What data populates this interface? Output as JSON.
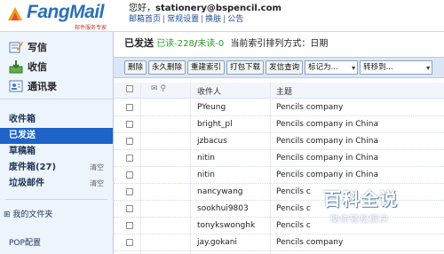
{
  "header": {
    "logo_text": "FangMail",
    "logo_sub": "邮件服务专家",
    "greeting_prefix": "您好，",
    "account": "stationery@bspencil.com",
    "nav": [
      "邮箱首页",
      "常规设置",
      "换肤",
      "公告"
    ]
  },
  "sidebar": {
    "quick": [
      {
        "label": "写信",
        "icon": "compose-icon"
      },
      {
        "label": "收信",
        "icon": "receive-icon"
      },
      {
        "label": "通讯录",
        "icon": "addressbook-icon"
      }
    ],
    "folders": [
      {
        "label": "收件箱",
        "active": false
      },
      {
        "label": "已发送",
        "active": true
      },
      {
        "label": "草稿箱",
        "active": false
      },
      {
        "label": "废件箱(27)",
        "active": false,
        "empty": "清空"
      },
      {
        "label": "垃圾邮件",
        "active": false,
        "empty": "清空"
      }
    ],
    "my_folders": "我的文件夹",
    "pop": "POP配置"
  },
  "main": {
    "title": "已发送",
    "read_label": "已读-228",
    "unread_label": "未读-0",
    "sort_text": "当前索引排列方式：日期",
    "toolbar": {
      "buttons": [
        "删除",
        "永久删除",
        "重建索引",
        "打包下载",
        "发信查询"
      ],
      "mark_as": "标记为...",
      "move_to": "转移到..."
    },
    "columns": {
      "recipient": "收件人",
      "subject": "主题"
    },
    "rows": [
      {
        "to": "PYeung",
        "subject": "Pencils company"
      },
      {
        "to": "bright_pl",
        "subject": "Pencils company in China"
      },
      {
        "to": "jzbacus",
        "subject": "Pencils company in China"
      },
      {
        "to": "nitin",
        "subject": "Pencils company in China"
      },
      {
        "to": "nitin",
        "subject": "Pencils company in China"
      },
      {
        "to": "nancywang",
        "subject": "Pencils c"
      },
      {
        "to": "sookhui9803",
        "subject": "Pencils c"
      },
      {
        "to": "tonykswonghk",
        "subject": "Pencils c"
      },
      {
        "to": "jay.gokani",
        "subject": "Pencils company"
      }
    ]
  },
  "watermark": {
    "big": "百科全说",
    "small": "助你轻松解决"
  }
}
